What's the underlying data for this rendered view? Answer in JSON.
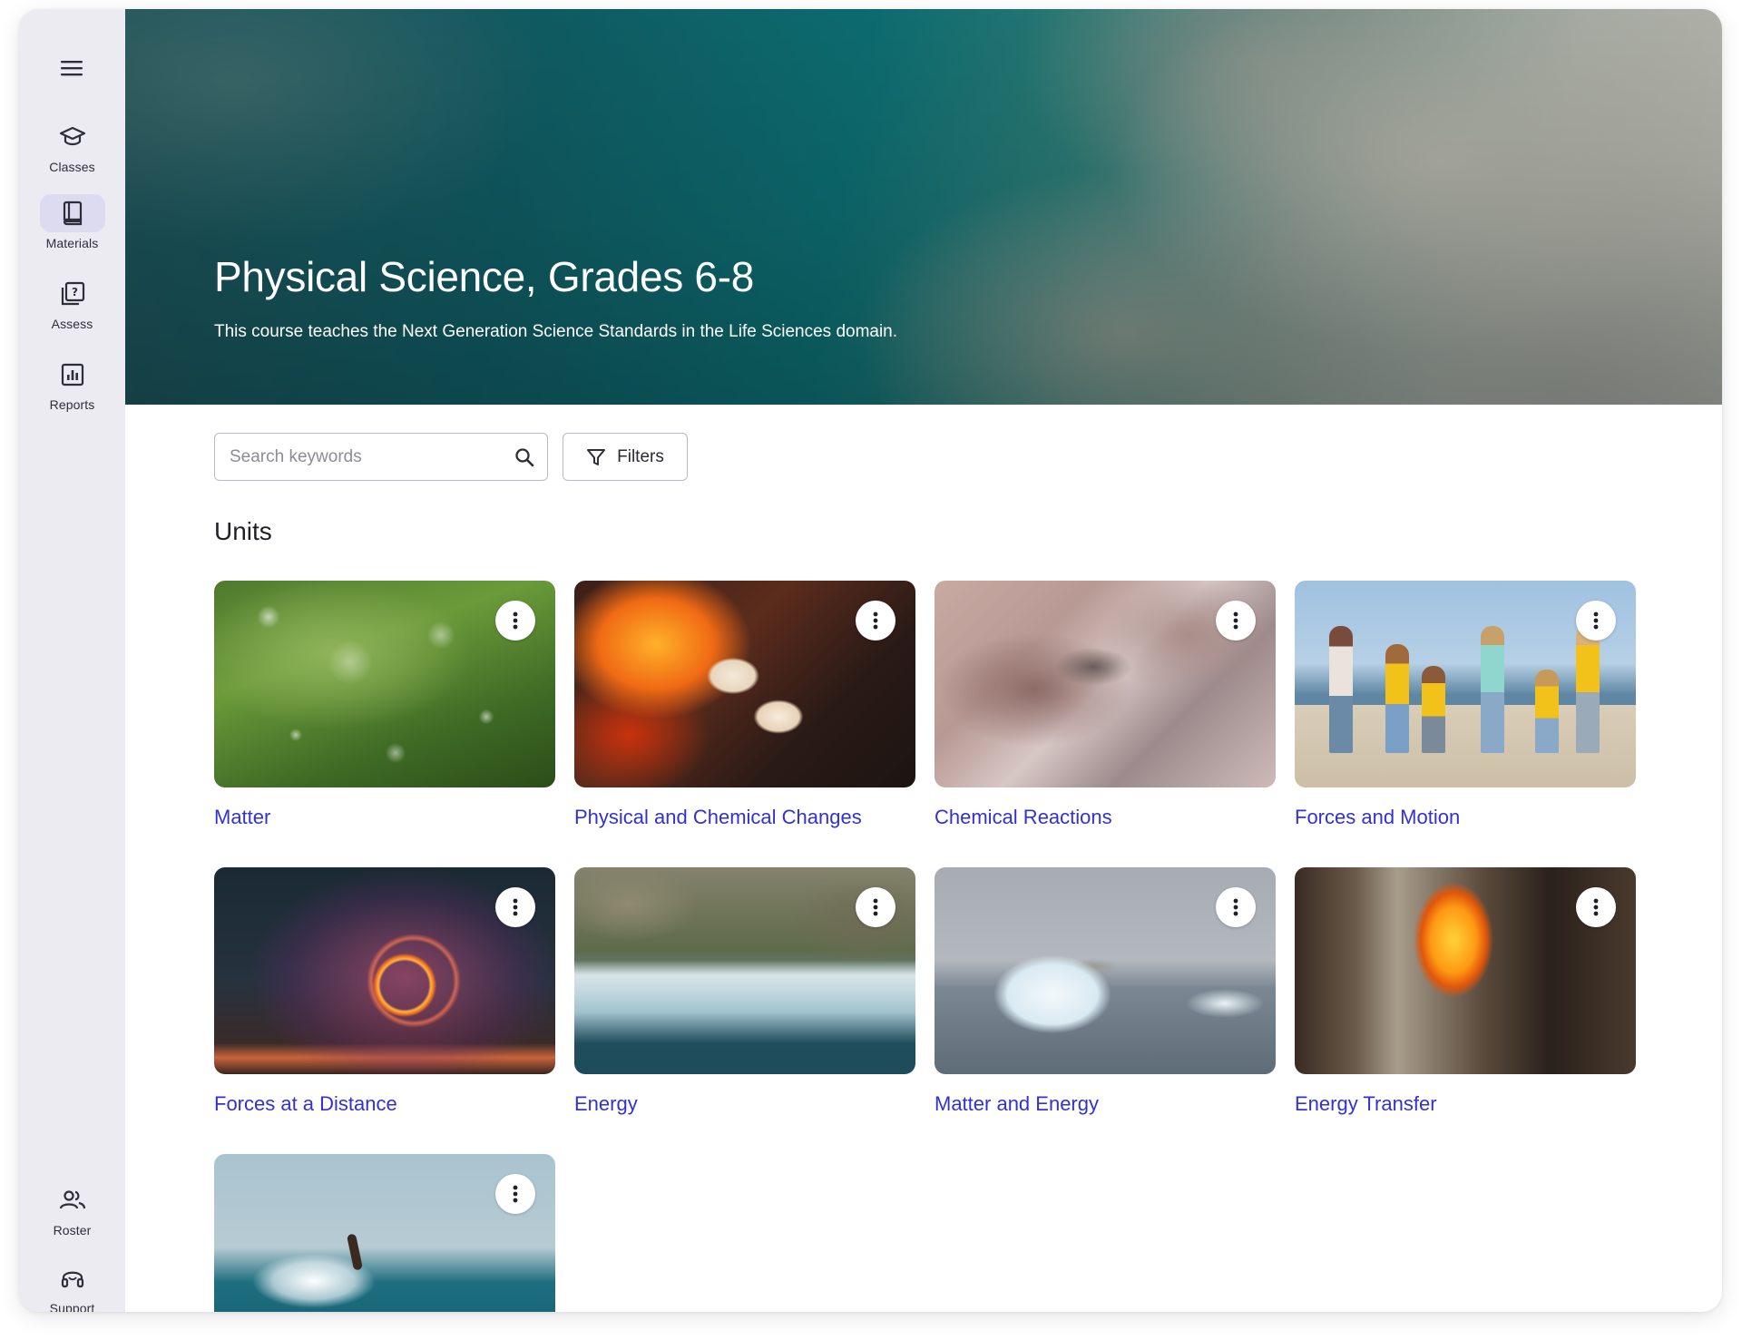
{
  "sidebar": {
    "menu_icon": "hamburger-menu-icon",
    "nav": [
      {
        "label": "Classes",
        "icon": "graduation-cap-icon",
        "active": false
      },
      {
        "label": "Materials",
        "icon": "book-icon",
        "active": true
      },
      {
        "label": "Assess",
        "icon": "question-book-icon",
        "active": false
      },
      {
        "label": "Reports",
        "icon": "bar-chart-icon",
        "active": false
      }
    ],
    "bottom_nav": [
      {
        "label": "Roster",
        "icon": "people-icon"
      },
      {
        "label": "Support",
        "icon": "headset-icon"
      }
    ],
    "active_bg": "#dcdbf0"
  },
  "hero": {
    "title": "Physical Science, Grades 6-8",
    "subtitle": "This course teaches the Next Generation Science Standards in the Life Sciences domain."
  },
  "toolbar": {
    "search_placeholder": "Search keywords",
    "search_icon": "search-icon",
    "filters_label": "Filters",
    "filters_icon": "filter-funnel-icon"
  },
  "units": {
    "heading": "Units",
    "link_color": "#3131d6",
    "items": [
      {
        "title": "Matter"
      },
      {
        "title": "Physical and Chemical Changes"
      },
      {
        "title": "Chemical Reactions"
      },
      {
        "title": "Forces and Motion"
      },
      {
        "title": "Forces at a Distance"
      },
      {
        "title": "Energy"
      },
      {
        "title": "Matter and Energy"
      },
      {
        "title": "Energy Transfer"
      },
      {
        "title": ""
      }
    ],
    "more_icon": "more-vertical-icon"
  }
}
